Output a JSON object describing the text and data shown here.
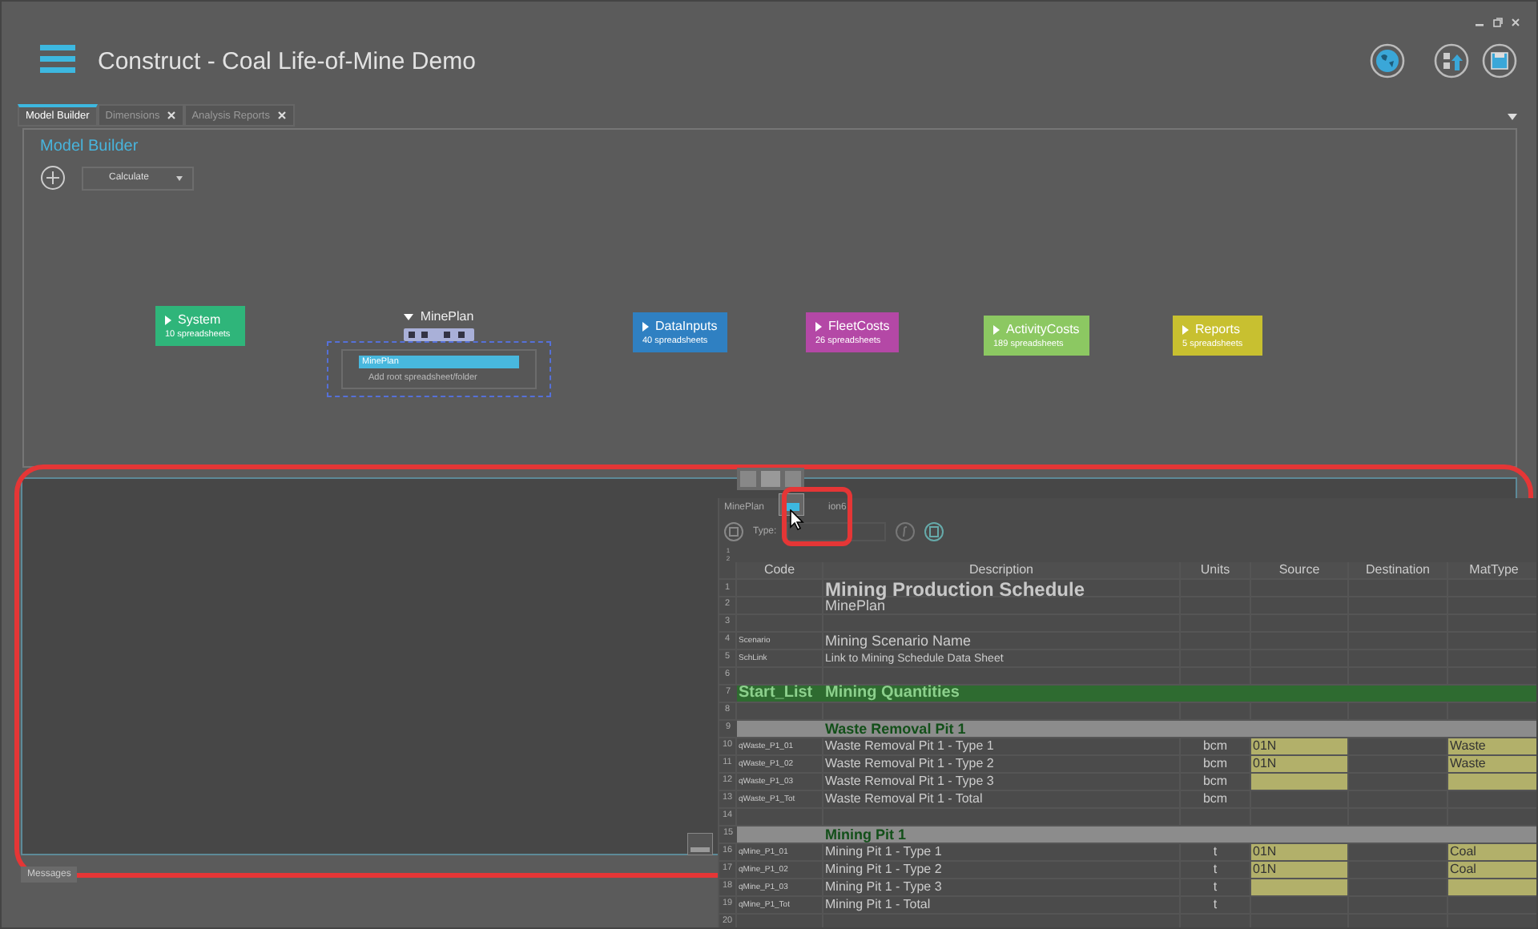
{
  "window": {
    "title": "Construct - Coal Life-of-Mine Demo"
  },
  "tabs": [
    {
      "label": "Model Builder",
      "selected": true,
      "closable": false
    },
    {
      "label": "Dimensions",
      "selected": false,
      "closable": true
    },
    {
      "label": "Analysis Reports",
      "selected": false,
      "closable": true
    }
  ],
  "model_builder": {
    "title": "Model Builder",
    "calculate": "Calculate",
    "nodes": [
      {
        "kind": "group",
        "label": "System",
        "count": "10 spreadsheets",
        "color": "#2fb57a"
      },
      {
        "kind": "folder",
        "label": "MinePlan",
        "items": [
          {
            "label": "MinePlan",
            "selected": true
          }
        ],
        "add_text": "Add root spreadsheet/folder"
      },
      {
        "kind": "group",
        "label": "DataInputs",
        "count": "40 spreadsheets",
        "color": "#2f80c2"
      },
      {
        "kind": "group",
        "label": "FleetCosts",
        "count": "26 spreadsheets",
        "color": "#b448a6"
      },
      {
        "kind": "group",
        "label": "ActivityCosts",
        "count": "189 spreadsheets",
        "color": "#8cc862"
      },
      {
        "kind": "group",
        "label": "Reports",
        "count": "5 spreadsheets",
        "color": "#c8c030"
      }
    ]
  },
  "spreadsheet": {
    "title": "MinePlan",
    "title_tail": "ion6",
    "type_label": "Type:",
    "outline_levels": [
      "1",
      "2"
    ],
    "columns": [
      "Code",
      "Description",
      "Units",
      "Source",
      "Destination",
      "MatType"
    ],
    "rows": [
      {
        "number": "1",
        "kind": "title",
        "code": "",
        "description": "Mining Production Schedule"
      },
      {
        "number": "2",
        "kind": "subtitle",
        "code": "",
        "description": "MinePlan"
      },
      {
        "number": "3",
        "kind": "blank"
      },
      {
        "number": "4",
        "kind": "subtitle",
        "code": "Scenario",
        "description": "Mining Scenario Name"
      },
      {
        "number": "5",
        "kind": "normal",
        "code": "SchLink",
        "description": "Link to Mining Schedule Data Sheet"
      },
      {
        "number": "6",
        "kind": "blank"
      },
      {
        "number": "7",
        "kind": "list_start",
        "code": "Start_List",
        "description": "Mining Quantities"
      },
      {
        "number": "8",
        "kind": "blank"
      },
      {
        "number": "9",
        "kind": "section",
        "code": "",
        "description": "Waste Removal Pit 1"
      },
      {
        "number": "10",
        "kind": "item",
        "code": "qWaste_P1_01",
        "description": "Waste Removal Pit 1 - Type 1",
        "units": "bcm",
        "source": "01N",
        "mattype": "Waste",
        "input": true
      },
      {
        "number": "11",
        "kind": "item",
        "code": "qWaste_P1_02",
        "description": "Waste Removal Pit 1 - Type 2",
        "units": "bcm",
        "source": "01N",
        "mattype": "Waste",
        "input": true
      },
      {
        "number": "12",
        "kind": "item",
        "code": "qWaste_P1_03",
        "description": "Waste Removal Pit 1 - Type 3",
        "units": "bcm",
        "input": true
      },
      {
        "number": "13",
        "kind": "item",
        "code": "qWaste_P1_Tot",
        "description": "Waste Removal Pit 1 - Total",
        "units": "bcm",
        "input": false
      },
      {
        "number": "14",
        "kind": "blank"
      },
      {
        "number": "15",
        "kind": "section",
        "code": "",
        "description": "Mining Pit 1"
      },
      {
        "number": "16",
        "kind": "item",
        "code": "qMine_P1_01",
        "description": "Mining Pit 1 - Type 1",
        "units": "t",
        "source": "01N",
        "mattype": "Coal",
        "input": true
      },
      {
        "number": "17",
        "kind": "item",
        "code": "qMine_P1_02",
        "description": "Mining Pit 1 - Type 2",
        "units": "t",
        "source": "01N",
        "mattype": "Coal",
        "input": true
      },
      {
        "number": "18",
        "kind": "item",
        "code": "qMine_P1_03",
        "description": "Mining Pit 1 - Type 3",
        "units": "t",
        "input": true
      },
      {
        "number": "19",
        "kind": "item",
        "code": "qMine_P1_Tot",
        "description": "Mining Pit 1 - Total",
        "units": "t",
        "input": false
      },
      {
        "number": "20",
        "kind": "blank"
      }
    ]
  },
  "messages_tab": "Messages"
}
